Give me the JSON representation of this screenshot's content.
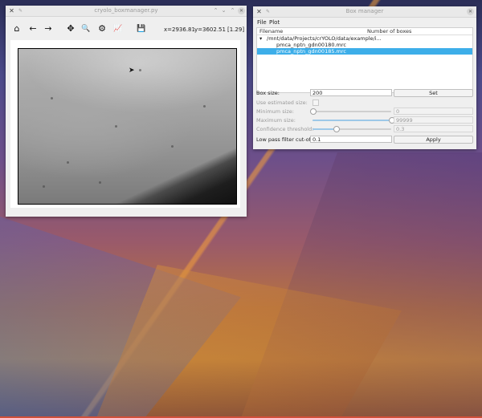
{
  "plot_window": {
    "title": "cryolo_boxmanager.py",
    "toolbar": {
      "home": "⌂",
      "back": "←",
      "forward": "→",
      "pan": "✥",
      "zoom": "🔍",
      "configure": "⚙",
      "edit_curves": "📈",
      "save": "💾"
    },
    "coords": {
      "x": "x=2936.81",
      "y": "y=3602.51",
      "value": "[1.29]"
    }
  },
  "box_manager": {
    "title": "Box manager",
    "menu": {
      "file": "File",
      "plot": "Plot"
    },
    "tree": {
      "col_filename": "Filename",
      "col_boxes": "Number of boxes",
      "root": "/mnt/data/Projects/crYOLO/data/example/i...",
      "items": [
        {
          "name": "pmca_nptn_gdn00180.mrc",
          "boxes": "",
          "selected": false
        },
        {
          "name": "pmca_nptn_gdn00185.mrc",
          "boxes": "",
          "selected": true
        }
      ]
    },
    "form": {
      "box_size_label": "Box size:",
      "box_size_value": "200",
      "set_label": "Set",
      "use_estimated_label": "Use estimated size:",
      "min_size_label": "Minimum size:",
      "min_size_value": "0",
      "min_size_slider": 0.0,
      "max_size_label": "Maximum size:",
      "max_size_value": "99999",
      "max_size_slider": 1.0,
      "confidence_label": "Confidence threshold:",
      "confidence_value": "0.3",
      "confidence_slider": 0.3,
      "lowpass_label": "Low pass filter cut-off:",
      "lowpass_value": "0.1",
      "apply_label": "Apply"
    }
  },
  "colors": {
    "selection": "#3daee9",
    "window_bg": "#efefef"
  }
}
